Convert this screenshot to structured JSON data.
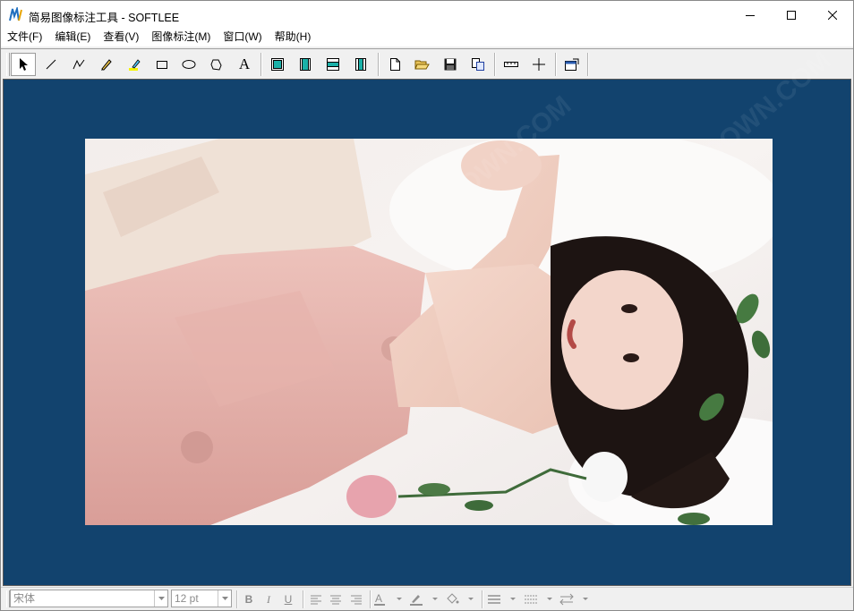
{
  "window": {
    "title": "简易图像标注工具 - SOFTLEE",
    "controls": [
      "minimize",
      "maximize",
      "close"
    ]
  },
  "menu": [
    {
      "label": "文件(F)"
    },
    {
      "label": "编辑(E)"
    },
    {
      "label": "查看(V)"
    },
    {
      "label": "图像标注(M)"
    },
    {
      "label": "窗口(W)"
    },
    {
      "label": "帮助(H)"
    }
  ],
  "toolbar": {
    "tools": [
      {
        "name": "select-arrow-icon",
        "active": true
      },
      {
        "name": "line-tool-icon"
      },
      {
        "name": "polyline-tool-icon"
      },
      {
        "name": "pencil-tool-icon"
      },
      {
        "name": "highlighter-tool-icon"
      },
      {
        "name": "rectangle-tool-icon"
      },
      {
        "name": "ellipse-tool-icon"
      },
      {
        "name": "polygon-tool-icon"
      },
      {
        "name": "text-tool-icon",
        "glyph": "A"
      },
      {
        "name": "frame-full-icon"
      },
      {
        "name": "frame-vertical-icon"
      },
      {
        "name": "frame-horizontal-icon"
      },
      {
        "name": "frame-side-icon"
      },
      {
        "name": "new-file-icon"
      },
      {
        "name": "open-folder-icon"
      },
      {
        "name": "save-disk-icon"
      },
      {
        "name": "copy-pages-icon"
      },
      {
        "name": "ruler-icon"
      },
      {
        "name": "crosshair-icon"
      },
      {
        "name": "properties-icon"
      }
    ]
  },
  "canvas": {
    "background": "#12436e",
    "image_alt": "photo of a woman in a pink dress lying on white fur with roses"
  },
  "format_bar": {
    "font_value": "宋体",
    "size_value": "12 pt",
    "bold_label": "B",
    "italic_label": "I",
    "underline_label": "U"
  },
  "watermark": "WEIDOWN.COM",
  "colors": {
    "canvas_bg": "#12436e",
    "toolbar_bg": "#f0f0f0",
    "dress": "#e8b9b3"
  }
}
